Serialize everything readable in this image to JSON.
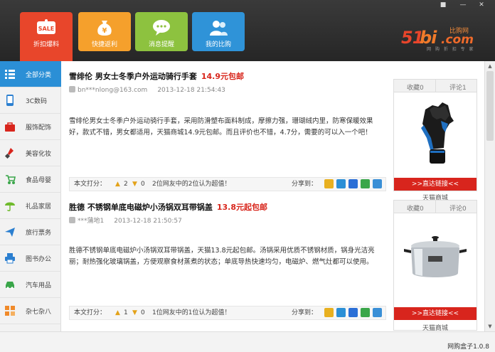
{
  "header": {
    "tiles": [
      {
        "label": "折扣爆料",
        "color": "#e8462b",
        "icon": "sale-tag-icon",
        "icon_text": "SALE"
      },
      {
        "label": "快捷返利",
        "color": "#f5a02c",
        "icon": "yen-bag-icon",
        "icon_text": "¥"
      },
      {
        "label": "消息提醒",
        "color": "#8dc23f",
        "icon": "chat-bubble-icon",
        "icon_text": ""
      },
      {
        "label": "我的比购",
        "color": "#2f93d8",
        "icon": "users-icon",
        "icon_text": ""
      }
    ],
    "logo": {
      "num": "51",
      "brand": "bi",
      "com": ".com",
      "cn": "比购网",
      "slogan": "网 购 折 扣 专 家"
    },
    "window_controls": [
      "user-icon",
      "minimize-icon",
      "close-icon"
    ]
  },
  "sidebar": {
    "items": [
      {
        "label": "全部分类",
        "icon": "list-icon",
        "color": "#ffffff"
      },
      {
        "label": "3C数码",
        "icon": "phone-icon",
        "color": "#2b7fd0"
      },
      {
        "label": "服饰配饰",
        "icon": "bag-icon",
        "color": "#d8251d"
      },
      {
        "label": "美容化妆",
        "icon": "lipstick-icon",
        "color": "#d8251d"
      },
      {
        "label": "食品母婴",
        "icon": "stroller-icon",
        "color": "#3aa64a"
      },
      {
        "label": "礼品家居",
        "icon": "umbrella-icon",
        "color": "#6fba2c"
      },
      {
        "label": "旅行票务",
        "icon": "plane-icon",
        "color": "#2b7fd0"
      },
      {
        "label": "图书办公",
        "icon": "printer-icon",
        "color": "#2b7fd0"
      },
      {
        "label": "汽车用品",
        "icon": "car-icon",
        "color": "#3aa64a"
      },
      {
        "label": "杂七杂八",
        "icon": "grid-icon",
        "color": "#f08a2a"
      }
    ]
  },
  "posts": [
    {
      "title": "雪绯伦 男女士冬季户外运动骑行手套",
      "price": "14.9元包邮",
      "user": "bn***nlong@163.com",
      "time": "2013-12-18 21:54:43",
      "desc": "雪绯伦男女士冬季户外运动骑行手套，采用防滑塑布面料制成，摩擦力强，珊瑚绒内里，防寒保暖效果好，款式不错，男女都适用，天猫商城14.9元包邮。而且评价也不错，4.7分，需要的可以入一个吧！",
      "rate_label": "本文打分：",
      "up": "2",
      "down": "0",
      "summary": "2位网友中的2位认为超值！",
      "share_label": "分享到：",
      "card": {
        "tab1": "收藏0",
        "tab2": "评论1",
        "go": ">>直达链接<<",
        "store": "天猫商城",
        "image": "glove"
      }
    },
    {
      "title": "胜德 不锈钢单底电磁炉小汤锅双耳带锅盖",
      "price": "13.8元起包邮",
      "user": "***蒲地1",
      "time": "2013-12-18 21:50:57",
      "desc": "胜德不锈钢单底电磁炉小汤锅双耳带锅盖，天猫13.8元起包邮。汤锅采用优质不锈钢材质，锅身光洁亮丽；耐热强化玻璃锅盖，方便观察食材蒸煮的状态；单底导热快速均匀，电磁炉、燃气灶都可以使用。",
      "rate_label": "本文打分：",
      "up": "1",
      "down": "0",
      "summary": "1位网友中的1位认为超值！",
      "share_label": "分享到：",
      "card": {
        "tab1": "收藏0",
        "tab2": "评论0",
        "go": ">>直达链接<<",
        "store": "天猫商城",
        "image": "pot"
      }
    }
  ],
  "share_icons": [
    {
      "name": "qzone-icon",
      "color": "#e8b020"
    },
    {
      "name": "qq-icon",
      "color": "#2b8fd6"
    },
    {
      "name": "renren-icon",
      "color": "#2b6fd6"
    },
    {
      "name": "douban-icon",
      "color": "#3aa64a"
    },
    {
      "name": "weibo-icon",
      "color": "#3a8fd6"
    }
  ],
  "statusbar": {
    "version": "网购盒子1.0.8"
  }
}
